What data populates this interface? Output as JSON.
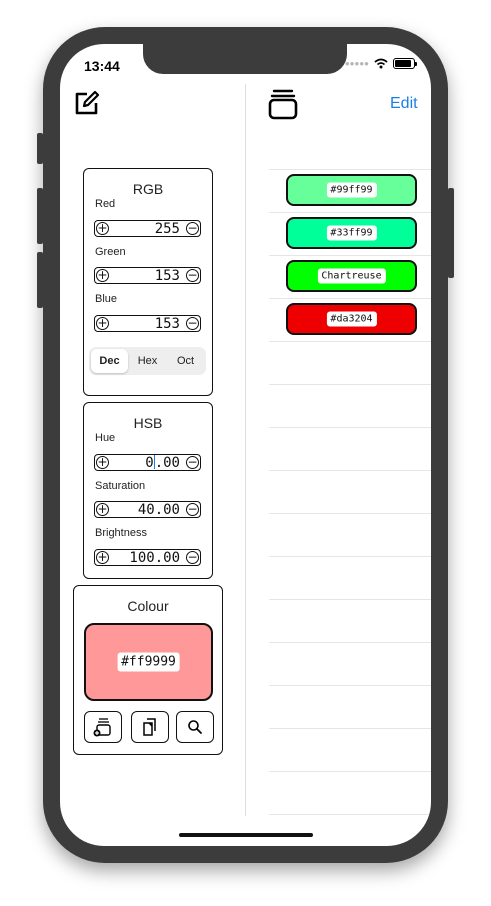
{
  "status_bar": {
    "time": "13:44"
  },
  "nav": {
    "edit_label": "Edit"
  },
  "rgb_panel": {
    "title": "RGB",
    "fields": [
      {
        "label": "Red",
        "value": "255"
      },
      {
        "label": "Green",
        "value": "153"
      },
      {
        "label": "Blue",
        "value": "153"
      }
    ],
    "format_options": [
      "Dec",
      "Hex",
      "Oct"
    ],
    "selected_format": "Dec"
  },
  "hsb_panel": {
    "title": "HSB",
    "fields": [
      {
        "label": "Hue",
        "value_before_cursor": "0",
        "value_after_cursor": ".00"
      },
      {
        "label": "Saturation",
        "value": "40.00"
      },
      {
        "label": "Brightness",
        "value": "100.00"
      }
    ]
  },
  "colour_panel": {
    "title": "Colour",
    "hex": "#ff9999",
    "color": "#ff9999"
  },
  "saved_colours": [
    {
      "label": "#99ff99",
      "color": "#66ff99"
    },
    {
      "label": "#33ff99",
      "color": "#00ff99"
    },
    {
      "label": "Chartreuse",
      "color": "#00ff00"
    },
    {
      "label": "#da3204",
      "color": "#ee0000"
    }
  ],
  "icons": {
    "compose": "compose-icon",
    "stack": "stack-icon",
    "add_to_stack": "add-to-stack-icon",
    "copy": "copy-icon",
    "search": "search-icon"
  },
  "colors": {
    "accent": "#1a7fe5",
    "device": "#3c3c3c"
  }
}
